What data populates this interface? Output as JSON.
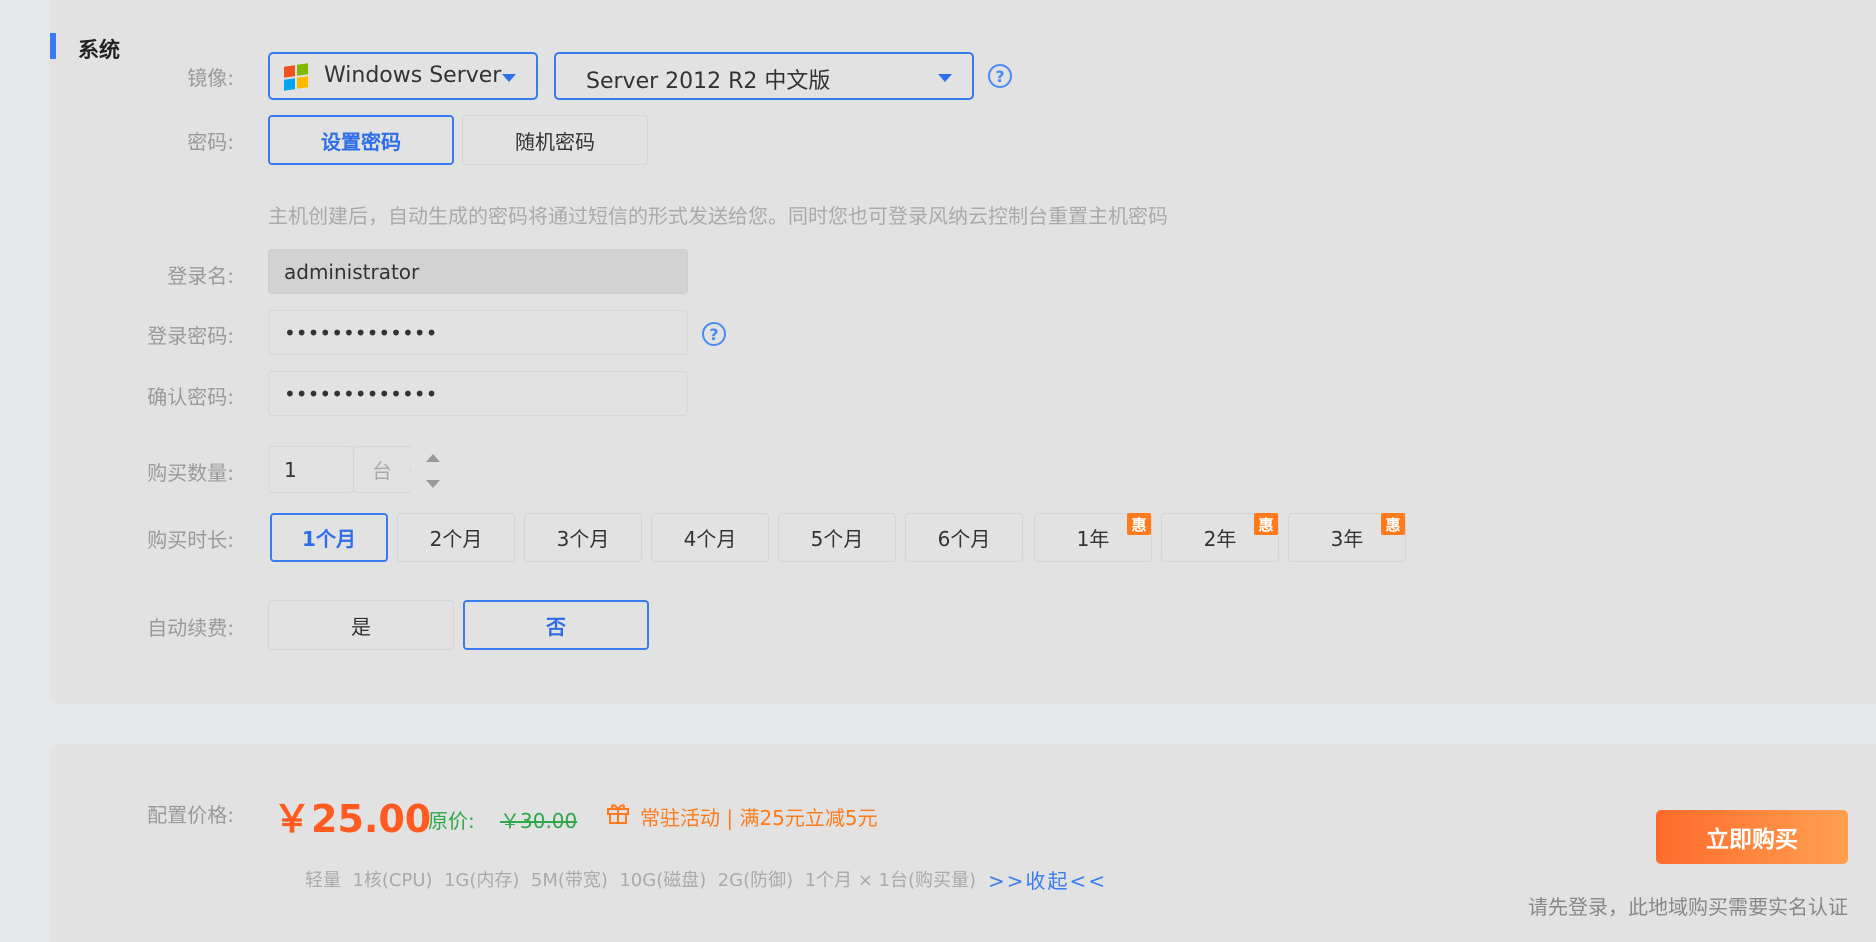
{
  "section": {
    "title": "系统"
  },
  "image": {
    "label": "镜像:",
    "os_family": "Windows Server",
    "os_version": "Server 2012 R2 中文版",
    "help": "?"
  },
  "password": {
    "label": "密码:",
    "options": [
      "设置密码",
      "随机密码"
    ],
    "selected": "设置密码",
    "hint": "主机创建后，自动生成的密码将通过短信的形式发送给您。同时您也可登录风纳云控制台重置主机密码"
  },
  "login_name": {
    "label": "登录名:",
    "value": "administrator"
  },
  "login_password": {
    "label": "登录密码:",
    "value": "•••••••••••••",
    "help": "?"
  },
  "confirm_password": {
    "label": "确认密码:",
    "value": "•••••••••••••"
  },
  "quantity": {
    "label": "购买数量:",
    "value": "1",
    "unit": "台"
  },
  "duration": {
    "label": "购买时长:",
    "options": [
      "1个月",
      "2个月",
      "3个月",
      "4个月",
      "5个月",
      "6个月",
      "1年",
      "2年",
      "3年"
    ],
    "badge": "惠",
    "selected": "1个月"
  },
  "auto_renew": {
    "label": "自动续费:",
    "options": [
      "是",
      "否"
    ],
    "selected": "否"
  },
  "price": {
    "label": "配置价格:",
    "amount": "￥25.00",
    "original_label": "原价:",
    "original_value": "￥30.00",
    "promo": "常驻活动 | 满25元立减5元",
    "summary": "轻量  1核(CPU)  1G(内存)  5M(带宽)  10G(磁盘)  2G(防御)  1个月 × 1台(购买量)",
    "collapse": ">>收起<<",
    "buy_button": "立即购买",
    "notice": "请先登录，此地域购买需要实名认证"
  },
  "colors": {
    "accent": "#3a7bf0",
    "price": "#ff5a1f",
    "promo": "#ff7a1a",
    "original_price": "#2ea84a",
    "button_gradient_start": "#ff6a2a",
    "button_gradient_end": "#ffa050"
  }
}
